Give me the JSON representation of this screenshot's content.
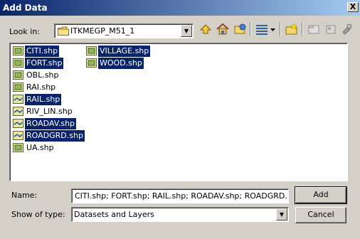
{
  "window": {
    "title": "Add Data",
    "close_glyph": "X"
  },
  "lookin": {
    "label": "Look in:",
    "value": "ITKMEGP_M51_1",
    "icon": "folder-icon"
  },
  "toolbar": {
    "items": [
      {
        "name": "up-one-level-icon"
      },
      {
        "name": "home-icon"
      },
      {
        "name": "connect-folder-icon"
      },
      {
        "name": "view-list-icon"
      },
      {
        "name": "view-dropdown-icon"
      },
      {
        "name": "new-folder-icon"
      },
      {
        "name": "catalog-icon"
      },
      {
        "name": "gallery-icon"
      },
      {
        "name": "tools-icon"
      }
    ]
  },
  "files": [
    {
      "name": "CITI.shp",
      "type": "polygon",
      "selected": true
    },
    {
      "name": "FORT.shp",
      "type": "polygon",
      "selected": true
    },
    {
      "name": "OBL.shp",
      "type": "polygon",
      "selected": false
    },
    {
      "name": "RAI.shp",
      "type": "polygon",
      "selected": false
    },
    {
      "name": "RAIL.shp",
      "type": "line",
      "selected": true
    },
    {
      "name": "RIV_LIN.shp",
      "type": "line",
      "selected": false
    },
    {
      "name": "ROADAV.shp",
      "type": "line",
      "selected": true
    },
    {
      "name": "ROADGRD.shp",
      "type": "line",
      "selected": true
    },
    {
      "name": "UA.shp",
      "type": "polygon",
      "selected": false
    },
    {
      "name": "VILLAGE.shp",
      "type": "polygon",
      "selected": true
    },
    {
      "name": "WOOD.shp",
      "type": "polygon",
      "selected": true
    }
  ],
  "name_field": {
    "label": "Name:",
    "value": "CITI.shp; FORT.shp; RAIL.shp; ROADAV.shp; ROADGRD."
  },
  "type_field": {
    "label": "Show of type:",
    "value": "Datasets and Layers"
  },
  "buttons": {
    "add": "Add",
    "cancel": "Cancel"
  },
  "colors": {
    "selection": "#0a246a",
    "dialog_bg": "#d4d0c8"
  }
}
